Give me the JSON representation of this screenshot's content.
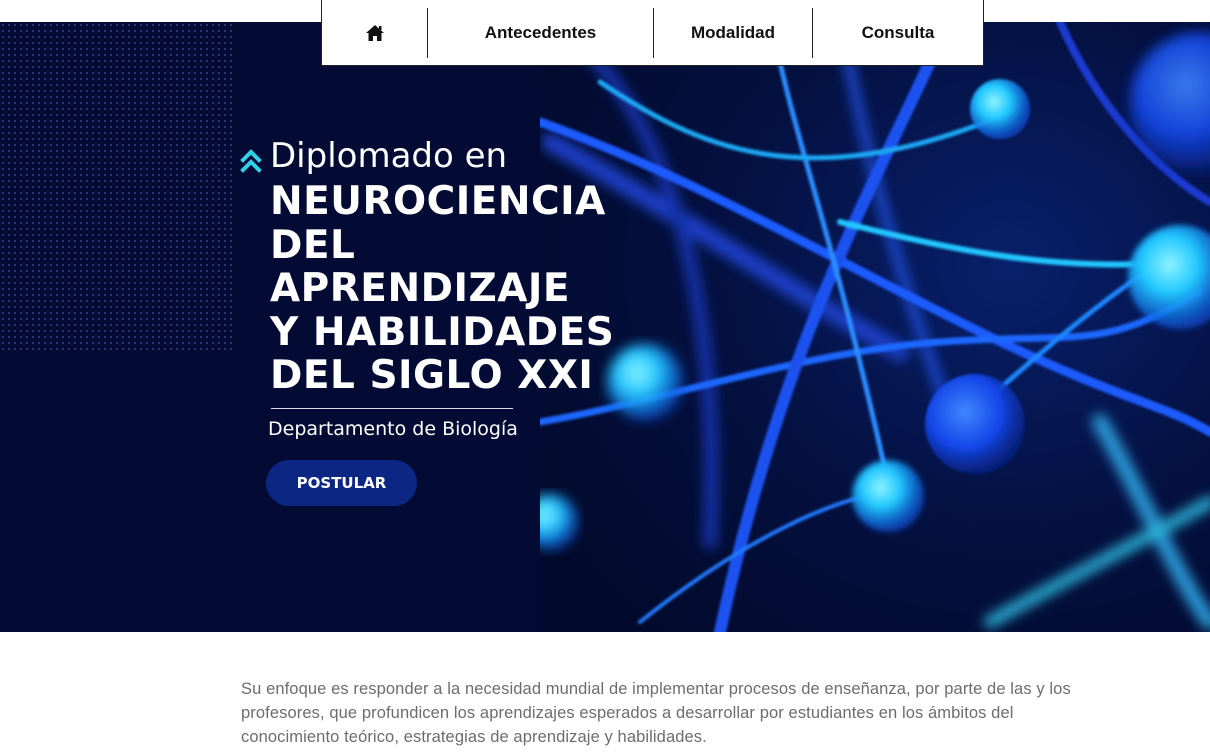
{
  "nav": {
    "home_icon": "home-icon",
    "items": [
      {
        "label": "Antecedentes"
      },
      {
        "label": "Modalidad"
      },
      {
        "label": "Consulta"
      }
    ]
  },
  "hero": {
    "pre_title": "Diplomado en",
    "title_lines": [
      "NEUROCIENCIA",
      "DEL",
      "APRENDIZAJE",
      "Y HABILIDADES",
      "DEL SIGLO XXI"
    ],
    "department": "Departamento de Biología",
    "cta_label": "POSTULAR",
    "accent_icon": "double-chevron-up-icon",
    "colors": {
      "background": "#030a33",
      "accent": "#2fd3e6",
      "button": "#0b2683"
    }
  },
  "intro": {
    "text": "Su enfoque es responder a la necesidad mundial de implementar procesos de enseñanza, por parte de las y los profesores, que profundicen los aprendizajes esperados a desarrollar por estudiantes en los ámbitos del conocimiento teórico, estrategias de aprendizaje y habilidades."
  }
}
